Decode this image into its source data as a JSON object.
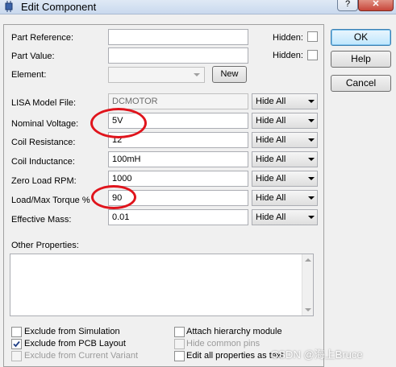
{
  "window": {
    "title": "Edit Component",
    "help_label": "?",
    "close_label": "✕"
  },
  "fields": {
    "part_reference": {
      "label": "Part Reference:",
      "value": "",
      "hidden_label": "Hidden:"
    },
    "part_value": {
      "label": "Part Value:",
      "value": "",
      "hidden_label": "Hidden:"
    },
    "element": {
      "label": "Element:",
      "value": "",
      "new_label": "New"
    }
  },
  "properties": [
    {
      "label": "LISA Model File:",
      "value": "DCMOTOR",
      "visibility": "Hide All"
    },
    {
      "label": "Nominal Voltage:",
      "value": "5V",
      "visibility": "Hide All"
    },
    {
      "label": "Coil Resistance:",
      "value": "12",
      "visibility": "Hide All"
    },
    {
      "label": "Coil Inductance:",
      "value": "100mH",
      "visibility": "Hide All"
    },
    {
      "label": "Zero Load RPM:",
      "value": "1000",
      "visibility": "Hide All"
    },
    {
      "label": "Load/Max Torque %",
      "value": "90",
      "visibility": "Hide All"
    },
    {
      "label": "Effective Mass:",
      "value": "0.01",
      "visibility": "Hide All"
    }
  ],
  "other_properties": {
    "label": "Other Properties:",
    "value": ""
  },
  "options": {
    "exclude_simulation": {
      "label": "Exclude from Simulation",
      "checked": false
    },
    "exclude_pcb": {
      "label": "Exclude from PCB Layout",
      "checked": true
    },
    "exclude_variant": {
      "label": "Exclude from Current Variant",
      "checked": false,
      "disabled": true
    },
    "attach_hierarchy": {
      "label": "Attach hierarchy module",
      "checked": false
    },
    "hide_common_pins": {
      "label": "Hide common pins",
      "checked": false,
      "disabled": true
    },
    "edit_all_text": {
      "label": "Edit all properties as text",
      "checked": false
    }
  },
  "buttons": {
    "ok": "OK",
    "help": "Help",
    "cancel": "Cancel"
  },
  "watermark": "CSDN @海上Bruce",
  "annotation_color": "#e0141c"
}
